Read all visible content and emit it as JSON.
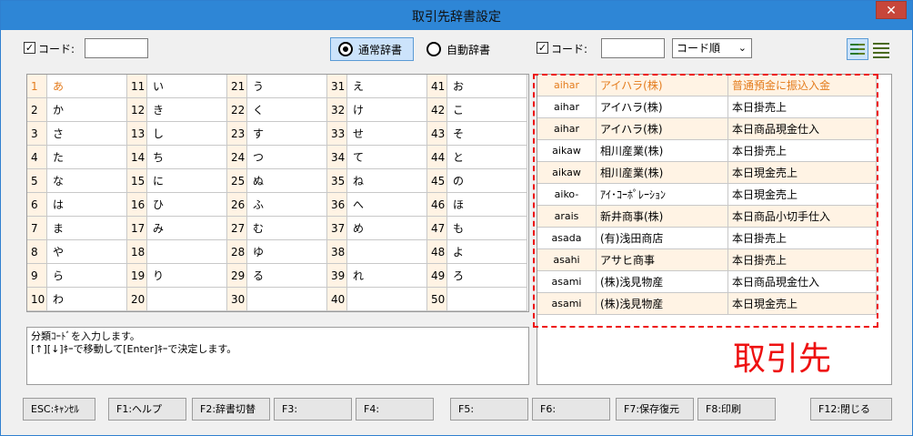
{
  "window": {
    "title": "取引先辞書設定",
    "close_glyph": "✕"
  },
  "toolbar": {
    "left_checkbox_label": "コード:",
    "left_code_value": "",
    "radio_normal": "通常辞書",
    "radio_auto": "自動辞書",
    "right_checkbox_label": "コード:",
    "right_code_value": "",
    "sort_select": "コード順"
  },
  "kana_grid": [
    [
      "1",
      "あ"
    ],
    [
      "11",
      "い"
    ],
    [
      "21",
      "う"
    ],
    [
      "31",
      "え"
    ],
    [
      "41",
      "お"
    ],
    [
      "2",
      "か"
    ],
    [
      "12",
      "き"
    ],
    [
      "22",
      "く"
    ],
    [
      "32",
      "け"
    ],
    [
      "42",
      "こ"
    ],
    [
      "3",
      "さ"
    ],
    [
      "13",
      "し"
    ],
    [
      "23",
      "す"
    ],
    [
      "33",
      "せ"
    ],
    [
      "43",
      "そ"
    ],
    [
      "4",
      "た"
    ],
    [
      "14",
      "ち"
    ],
    [
      "24",
      "つ"
    ],
    [
      "34",
      "て"
    ],
    [
      "44",
      "と"
    ],
    [
      "5",
      "な"
    ],
    [
      "15",
      "に"
    ],
    [
      "25",
      "ぬ"
    ],
    [
      "35",
      "ね"
    ],
    [
      "45",
      "の"
    ],
    [
      "6",
      "は"
    ],
    [
      "16",
      "ひ"
    ],
    [
      "26",
      "ふ"
    ],
    [
      "36",
      "へ"
    ],
    [
      "46",
      "ほ"
    ],
    [
      "7",
      "ま"
    ],
    [
      "17",
      "み"
    ],
    [
      "27",
      "む"
    ],
    [
      "37",
      "め"
    ],
    [
      "47",
      "も"
    ],
    [
      "8",
      "や"
    ],
    [
      "18",
      ""
    ],
    [
      "28",
      "ゆ"
    ],
    [
      "38",
      ""
    ],
    [
      "48",
      "よ"
    ],
    [
      "9",
      "ら"
    ],
    [
      "19",
      "り"
    ],
    [
      "29",
      "る"
    ],
    [
      "39",
      "れ"
    ],
    [
      "49",
      "ろ"
    ],
    [
      "10",
      "わ"
    ],
    [
      "20",
      ""
    ],
    [
      "30",
      ""
    ],
    [
      "40",
      ""
    ],
    [
      "50",
      ""
    ]
  ],
  "message": {
    "line1": "分類ｺｰﾄﾞを入力します。",
    "line2": "[↑][↓]ｷｰで移動して[Enter]ｷｰで決定します。"
  },
  "dictionary_rows": [
    {
      "code": "aihar",
      "name": "アイハラ(株)",
      "desc": "普通預金に振込入金"
    },
    {
      "code": "aihar",
      "name": "アイハラ(株)",
      "desc": "本日掛売上"
    },
    {
      "code": "aihar",
      "name": "アイハラ(株)",
      "desc": "本日商品現金仕入"
    },
    {
      "code": "aikaw",
      "name": "相川産業(株)",
      "desc": "本日掛売上"
    },
    {
      "code": "aikaw",
      "name": "相川産業(株)",
      "desc": "本日現金売上"
    },
    {
      "code": "aiko-",
      "name": "ｱｲ･ｺｰﾎﾟﾚｰｼｮﾝ",
      "desc": "本日現金売上"
    },
    {
      "code": "arais",
      "name": "新井商事(株)",
      "desc": "本日商品小切手仕入"
    },
    {
      "code": "asada",
      "name": "(有)浅田商店",
      "desc": "本日掛売上"
    },
    {
      "code": "asahi",
      "name": "アサヒ商事",
      "desc": "本日掛売上"
    },
    {
      "code": "asami",
      "name": "(株)浅見物産",
      "desc": "本日商品現金仕入"
    },
    {
      "code": "asami",
      "name": "(株)浅見物産",
      "desc": "本日現金売上"
    }
  ],
  "annotation": "取引先",
  "fkeys": [
    "ESC:ｷｬﾝｾﾙ",
    "F1:ヘルプ",
    "F2:辞書切替",
    "F3:",
    "F4:",
    "F5:",
    "F6:",
    "F7:保存復元",
    "F8:印刷",
    "F12:閉じる"
  ],
  "colors": {
    "accent_orange": "#e47c1d",
    "annotation_red": "#e11111",
    "titlebar": "#2e86d6"
  }
}
